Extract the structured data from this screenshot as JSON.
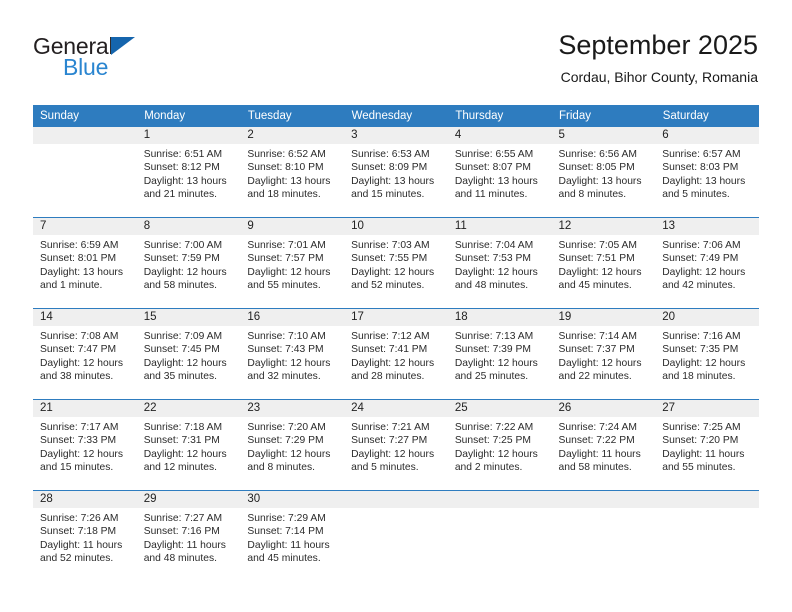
{
  "brand": {
    "name_top": "General",
    "name_bottom": "Blue",
    "triangle_color": "#1565ad",
    "text_color": "#231f20",
    "blue_color": "#2a85d0"
  },
  "header": {
    "title": "September 2025",
    "location": "Cordau, Bihor County, Romania"
  },
  "theme": {
    "header_blue": "#2e7cbf",
    "daynum_band": "#efefef",
    "cell_bg": "#ffffff",
    "text": "#2b2b2b"
  },
  "weekdays": [
    "Sunday",
    "Monday",
    "Tuesday",
    "Wednesday",
    "Thursday",
    "Friday",
    "Saturday"
  ],
  "weeks": [
    [
      {
        "day": "",
        "lines": []
      },
      {
        "day": "1",
        "lines": [
          "Sunrise: 6:51 AM",
          "Sunset: 8:12 PM",
          "Daylight: 13 hours",
          "and 21 minutes."
        ]
      },
      {
        "day": "2",
        "lines": [
          "Sunrise: 6:52 AM",
          "Sunset: 8:10 PM",
          "Daylight: 13 hours",
          "and 18 minutes."
        ]
      },
      {
        "day": "3",
        "lines": [
          "Sunrise: 6:53 AM",
          "Sunset: 8:09 PM",
          "Daylight: 13 hours",
          "and 15 minutes."
        ]
      },
      {
        "day": "4",
        "lines": [
          "Sunrise: 6:55 AM",
          "Sunset: 8:07 PM",
          "Daylight: 13 hours",
          "and 11 minutes."
        ]
      },
      {
        "day": "5",
        "lines": [
          "Sunrise: 6:56 AM",
          "Sunset: 8:05 PM",
          "Daylight: 13 hours",
          "and 8 minutes."
        ]
      },
      {
        "day": "6",
        "lines": [
          "Sunrise: 6:57 AM",
          "Sunset: 8:03 PM",
          "Daylight: 13 hours",
          "and 5 minutes."
        ]
      }
    ],
    [
      {
        "day": "7",
        "lines": [
          "Sunrise: 6:59 AM",
          "Sunset: 8:01 PM",
          "Daylight: 13 hours",
          "and 1 minute."
        ]
      },
      {
        "day": "8",
        "lines": [
          "Sunrise: 7:00 AM",
          "Sunset: 7:59 PM",
          "Daylight: 12 hours",
          "and 58 minutes."
        ]
      },
      {
        "day": "9",
        "lines": [
          "Sunrise: 7:01 AM",
          "Sunset: 7:57 PM",
          "Daylight: 12 hours",
          "and 55 minutes."
        ]
      },
      {
        "day": "10",
        "lines": [
          "Sunrise: 7:03 AM",
          "Sunset: 7:55 PM",
          "Daylight: 12 hours",
          "and 52 minutes."
        ]
      },
      {
        "day": "11",
        "lines": [
          "Sunrise: 7:04 AM",
          "Sunset: 7:53 PM",
          "Daylight: 12 hours",
          "and 48 minutes."
        ]
      },
      {
        "day": "12",
        "lines": [
          "Sunrise: 7:05 AM",
          "Sunset: 7:51 PM",
          "Daylight: 12 hours",
          "and 45 minutes."
        ]
      },
      {
        "day": "13",
        "lines": [
          "Sunrise: 7:06 AM",
          "Sunset: 7:49 PM",
          "Daylight: 12 hours",
          "and 42 minutes."
        ]
      }
    ],
    [
      {
        "day": "14",
        "lines": [
          "Sunrise: 7:08 AM",
          "Sunset: 7:47 PM",
          "Daylight: 12 hours",
          "and 38 minutes."
        ]
      },
      {
        "day": "15",
        "lines": [
          "Sunrise: 7:09 AM",
          "Sunset: 7:45 PM",
          "Daylight: 12 hours",
          "and 35 minutes."
        ]
      },
      {
        "day": "16",
        "lines": [
          "Sunrise: 7:10 AM",
          "Sunset: 7:43 PM",
          "Daylight: 12 hours",
          "and 32 minutes."
        ]
      },
      {
        "day": "17",
        "lines": [
          "Sunrise: 7:12 AM",
          "Sunset: 7:41 PM",
          "Daylight: 12 hours",
          "and 28 minutes."
        ]
      },
      {
        "day": "18",
        "lines": [
          "Sunrise: 7:13 AM",
          "Sunset: 7:39 PM",
          "Daylight: 12 hours",
          "and 25 minutes."
        ]
      },
      {
        "day": "19",
        "lines": [
          "Sunrise: 7:14 AM",
          "Sunset: 7:37 PM",
          "Daylight: 12 hours",
          "and 22 minutes."
        ]
      },
      {
        "day": "20",
        "lines": [
          "Sunrise: 7:16 AM",
          "Sunset: 7:35 PM",
          "Daylight: 12 hours",
          "and 18 minutes."
        ]
      }
    ],
    [
      {
        "day": "21",
        "lines": [
          "Sunrise: 7:17 AM",
          "Sunset: 7:33 PM",
          "Daylight: 12 hours",
          "and 15 minutes."
        ]
      },
      {
        "day": "22",
        "lines": [
          "Sunrise: 7:18 AM",
          "Sunset: 7:31 PM",
          "Daylight: 12 hours",
          "and 12 minutes."
        ]
      },
      {
        "day": "23",
        "lines": [
          "Sunrise: 7:20 AM",
          "Sunset: 7:29 PM",
          "Daylight: 12 hours",
          "and 8 minutes."
        ]
      },
      {
        "day": "24",
        "lines": [
          "Sunrise: 7:21 AM",
          "Sunset: 7:27 PM",
          "Daylight: 12 hours",
          "and 5 minutes."
        ]
      },
      {
        "day": "25",
        "lines": [
          "Sunrise: 7:22 AM",
          "Sunset: 7:25 PM",
          "Daylight: 12 hours",
          "and 2 minutes."
        ]
      },
      {
        "day": "26",
        "lines": [
          "Sunrise: 7:24 AM",
          "Sunset: 7:22 PM",
          "Daylight: 11 hours",
          "and 58 minutes."
        ]
      },
      {
        "day": "27",
        "lines": [
          "Sunrise: 7:25 AM",
          "Sunset: 7:20 PM",
          "Daylight: 11 hours",
          "and 55 minutes."
        ]
      }
    ],
    [
      {
        "day": "28",
        "lines": [
          "Sunrise: 7:26 AM",
          "Sunset: 7:18 PM",
          "Daylight: 11 hours",
          "and 52 minutes."
        ]
      },
      {
        "day": "29",
        "lines": [
          "Sunrise: 7:27 AM",
          "Sunset: 7:16 PM",
          "Daylight: 11 hours",
          "and 48 minutes."
        ]
      },
      {
        "day": "30",
        "lines": [
          "Sunrise: 7:29 AM",
          "Sunset: 7:14 PM",
          "Daylight: 11 hours",
          "and 45 minutes."
        ]
      },
      {
        "day": "",
        "lines": []
      },
      {
        "day": "",
        "lines": []
      },
      {
        "day": "",
        "lines": []
      },
      {
        "day": "",
        "lines": []
      }
    ]
  ]
}
